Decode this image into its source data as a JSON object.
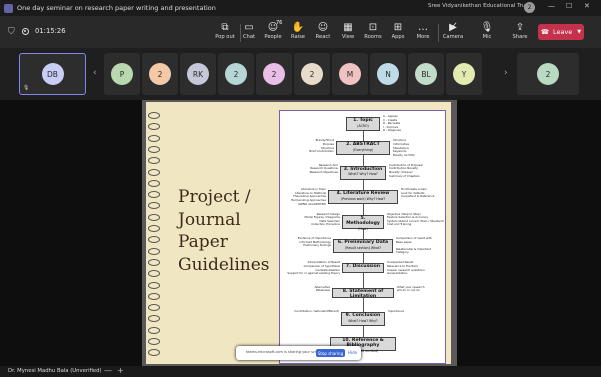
{
  "titlebar": {
    "title": "One day seminar on research paper writing and presentation",
    "org": "Sree Vidyanikethan Educational Trust",
    "org_avatar": "2",
    "minimize": "—",
    "maximize": "☐",
    "close": "✕"
  },
  "toolbar": {
    "timer": "01:15:26",
    "popout": "Pop out",
    "chat": "Chat",
    "people": "People",
    "people_count": "76",
    "raise": "Raise",
    "react": "React",
    "view": "View",
    "rooms": "Rooms",
    "apps": "Apps",
    "more": "More",
    "camera": "Camera",
    "mic": "Mic",
    "share": "Share",
    "leave": "Leave"
  },
  "participants": {
    "self_initials": "DB",
    "self_color": "#c7cdf5",
    "list": [
      {
        "initials": "P",
        "color": "#b9d8b0"
      },
      {
        "initials": "2",
        "color": "#f3c9a8"
      },
      {
        "initials": "RK",
        "color": "#c4c8d8"
      },
      {
        "initials": "2",
        "color": "#b6d6d6"
      },
      {
        "initials": "2",
        "color": "#e8bde6"
      },
      {
        "initials": "2",
        "color": "#e6dcc9"
      },
      {
        "initials": "M",
        "color": "#f0c2c2"
      },
      {
        "initials": "N",
        "color": "#bfdbe8"
      },
      {
        "initials": "BL",
        "color": "#c2dcc9"
      },
      {
        "initials": "Y",
        "color": "#e3eab2"
      }
    ],
    "overflow_label": "2",
    "overflow_color": "#b9d9c3"
  },
  "slide": {
    "title_text": "Project /\nJournal\nPaper\nGuidelines",
    "chart": {
      "steps": [
        {
          "label": "1. Topic",
          "sub": "(ACRO)"
        },
        {
          "label": "2. ABSTRACT",
          "sub": "(Everything)"
        },
        {
          "label": "3. Introduction",
          "sub": "What? Why? How?"
        },
        {
          "label": "4. Literature Review",
          "sub": "(Previous work)  Why? How?"
        },
        {
          "label": "5. Methodology",
          "sub": "(How)"
        },
        {
          "label": "6. Preliminary Data",
          "sub": "(Result section)  What?"
        },
        {
          "label": "7. Discussion",
          "sub": ""
        },
        {
          "label": "8. Statement of Limitation",
          "sub": ""
        },
        {
          "label": "9. Conclusion",
          "sub": "What? How? Why?"
        },
        {
          "label": "10. Reference & Bibliography",
          "sub": "(Cited and uncited)"
        }
      ],
      "left_notes": [
        "",
        "Brevity/Short\nPurpose\nStructure\nBrief Contribution",
        "Research Aim\nResearch Questions\nResearch Objectives",
        "Literature in Topic\nLiterature on Methods\nTheoretical Approaches\nHarmonizing Approaches\n(GENO ALGORITHM)",
        "Research Design\nModel Figures / Diagrams\nData Selection\nCollection Procedure",
        "Evidence of Importance\nInformed Methodology\nPreliminary findings",
        "Interpretation of Result\nComparison of hypothesis\nContextualisation\nSupport for or against existing theory",
        "Alternative\nWeakness",
        "Contribution (national/different)",
        ""
      ],
      "right_notes": [
        "A - Appear\nC - Create\nR - Recreate\nI - Improve\nD - Diagnose",
        "Structure\nInformative\nStandalone\nKeywords\nBrevity (al 500)",
        "Contribution of Proposal\nContribution Novelty\nNovelty (Unique)\nSummary of Chapters",
        "Find/Create a Gain\nLook for defaults\nConsistent to Reference",
        "Objective (Step to Step)\nFeature Selection & Accuracy\nSystem Output correct (Train / Standard)\nCost and Training",
        "Comparison of result with\nBase paper\n\nRelationship & Important\nCategory",
        "Unexpected Result\nRelevance to the field\nAnswer research questions\nGeneralization",
        "What your research\nwill do or not do",
        "Importance",
        ""
      ]
    }
  },
  "share_bar": {
    "message": "teams.microsoft.com is sharing your screen.",
    "stop": "Stop sharing",
    "hide": "Hide"
  },
  "bottom": {
    "presenter_name": "Dr. Mynesi Madhu Bala (Unverified)",
    "zoom_out": "—",
    "zoom_in": "+"
  }
}
